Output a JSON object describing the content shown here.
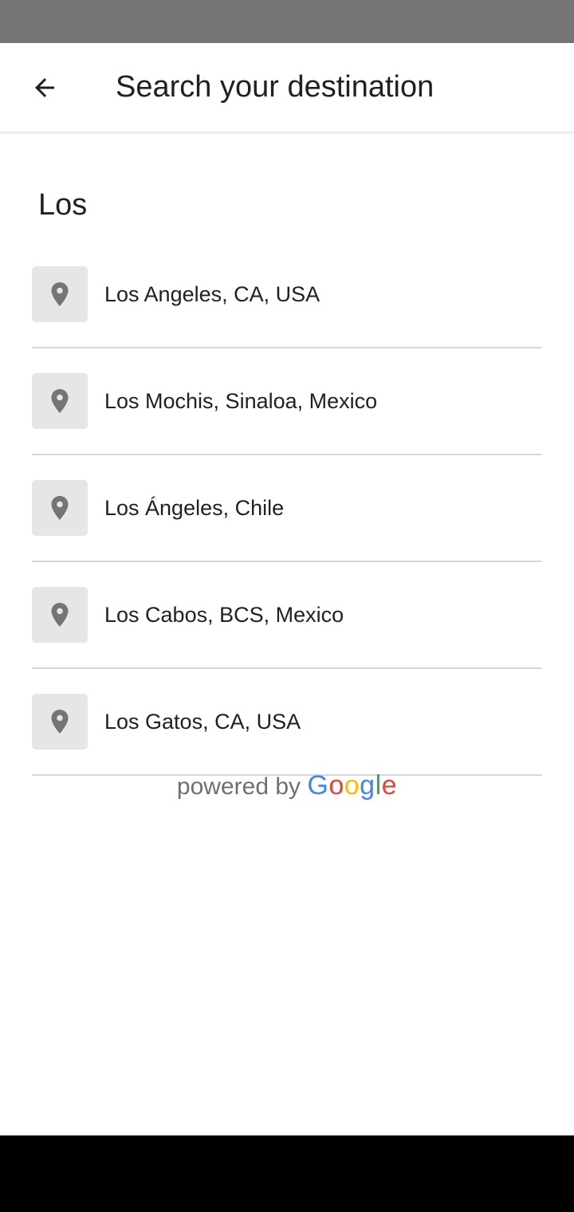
{
  "app_bar": {
    "back_icon": "arrow-back-icon",
    "title": "Search your destination"
  },
  "search": {
    "value": "Los"
  },
  "results": [
    {
      "label": "Los Angeles, CA, USA",
      "icon": "location-pin-icon"
    },
    {
      "label": "Los Mochis, Sinaloa, Mexico",
      "icon": "location-pin-icon"
    },
    {
      "label": "Los Ángeles, Chile",
      "icon": "location-pin-icon"
    },
    {
      "label": "Los Cabos, BCS, Mexico",
      "icon": "location-pin-icon"
    },
    {
      "label": "Los Gatos, CA, USA",
      "icon": "location-pin-icon"
    }
  ],
  "attribution": {
    "prefix": "powered by",
    "brand": "Google"
  },
  "colors": {
    "status_bar": "#757575",
    "pin": "#757575",
    "pin_bg": "#e6e6e6",
    "nav_bar": "#000000",
    "google_blue": "#4285F4",
    "google_red": "#EA4335",
    "google_yellow": "#FBBC05",
    "google_green": "#34A853"
  }
}
